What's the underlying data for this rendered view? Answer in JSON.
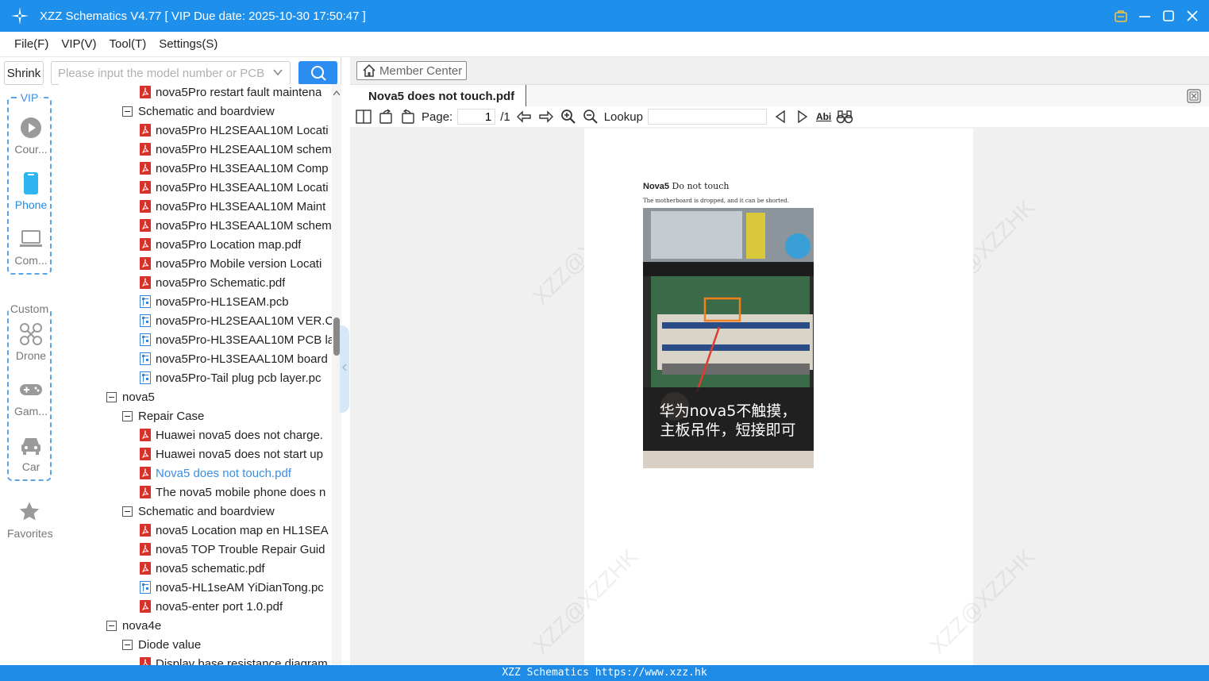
{
  "window": {
    "title": "XZZ Schematics V4.77 [ VIP Due date: 2025-10-30 17:50:47 ]",
    "accent": "#1e90ec"
  },
  "menu": [
    "File(F)",
    "VIP(V)",
    "Tool(T)",
    "Settings(S)"
  ],
  "search": {
    "shrink_label": "Shrink",
    "placeholder": "Please input the model number or PCB"
  },
  "leftnav": {
    "vip_label": "VIP",
    "custom_label": "Custom",
    "items": [
      {
        "label": "Cour...",
        "icon": "play-icon"
      },
      {
        "label": "Phone",
        "icon": "phone-icon"
      },
      {
        "label": "Com...",
        "icon": "laptop-icon"
      },
      {
        "label": "Drone",
        "icon": "drone-icon"
      },
      {
        "label": "Gam...",
        "icon": "gamepad-icon"
      },
      {
        "label": "Car",
        "icon": "car-icon"
      },
      {
        "label": "Favorites",
        "icon": "star-icon"
      }
    ]
  },
  "tree": [
    {
      "level": 2,
      "type": "pdf",
      "text": "nova5Pro restart fault maintena"
    },
    {
      "level": 1,
      "type": "folder",
      "text": "Schematic and boardview"
    },
    {
      "level": 2,
      "type": "pdf",
      "text": "nova5Pro HL2SEAAL10M Locati"
    },
    {
      "level": 2,
      "type": "pdf",
      "text": "nova5Pro HL2SEAAL10M schem"
    },
    {
      "level": 2,
      "type": "pdf",
      "text": "nova5Pro HL3SEAAL10M Comp"
    },
    {
      "level": 2,
      "type": "pdf",
      "text": "nova5Pro HL3SEAAL10M Locati"
    },
    {
      "level": 2,
      "type": "pdf",
      "text": "nova5Pro HL3SEAAL10M Maint"
    },
    {
      "level": 2,
      "type": "pdf",
      "text": "nova5Pro HL3SEAAL10M schem"
    },
    {
      "level": 2,
      "type": "pdf",
      "text": "nova5Pro Location map.pdf"
    },
    {
      "level": 2,
      "type": "pdf",
      "text": "nova5Pro Mobile version Locati"
    },
    {
      "level": 2,
      "type": "pdf",
      "text": "nova5Pro Schematic.pdf"
    },
    {
      "level": 2,
      "type": "pcb",
      "text": "nova5Pro-HL1SEAM.pcb"
    },
    {
      "level": 2,
      "type": "pcb",
      "text": "nova5Pro-HL2SEAAL10M VER.C"
    },
    {
      "level": 2,
      "type": "pcb",
      "text": "nova5Pro-HL3SEAAL10M PCB la"
    },
    {
      "level": 2,
      "type": "pcb",
      "text": "nova5Pro-HL3SEAAL10M board"
    },
    {
      "level": 2,
      "type": "pcb",
      "text": "nova5Pro-Tail plug pcb layer.pc"
    },
    {
      "level": 0,
      "type": "folder",
      "text": "nova5"
    },
    {
      "level": 1,
      "type": "folder",
      "text": "Repair Case"
    },
    {
      "level": 2,
      "type": "pdf",
      "text": "Huawei nova5 does not charge."
    },
    {
      "level": 2,
      "type": "pdf",
      "text": "Huawei nova5 does not start up"
    },
    {
      "level": 2,
      "type": "pdf",
      "text": "Nova5 does not touch.pdf",
      "selected": true
    },
    {
      "level": 2,
      "type": "pdf",
      "text": "The nova5 mobile phone does n"
    },
    {
      "level": 1,
      "type": "folder",
      "text": "Schematic and boardview"
    },
    {
      "level": 2,
      "type": "pdf",
      "text": "nova5 Location map en HL1SEA"
    },
    {
      "level": 2,
      "type": "pdf",
      "text": "nova5 TOP Trouble Repair Guid"
    },
    {
      "level": 2,
      "type": "pdf",
      "text": "nova5 schematic.pdf"
    },
    {
      "level": 2,
      "type": "pcb",
      "text": "nova5-HL1seAM YiDianTong.pc"
    },
    {
      "level": 2,
      "type": "pdf",
      "text": "nova5-enter port 1.0.pdf"
    },
    {
      "level": 0,
      "type": "folder",
      "text": "nova4e"
    },
    {
      "level": 1,
      "type": "folder",
      "text": "Diode value"
    },
    {
      "level": 2,
      "type": "pdf",
      "text": "Display base resistance diagram"
    }
  ],
  "viewer": {
    "member_center": "Member Center",
    "tab_title": "Nova5 does not touch.pdf",
    "page_label": "Page:",
    "page_value": "1",
    "page_total": "/1",
    "lookup_label": "Lookup",
    "abi": "Abi"
  },
  "pdf": {
    "title_bold": "Nova5",
    "title_rest": " Do not touch",
    "subtitle": "The motherboard is dropped, and it can be shorted.",
    "caption_line1": "华为nova5不触摸，",
    "caption_line2": "主板吊件，短接即可",
    "watermark": "XZZ@XZZHK"
  },
  "statusbar": "XZZ Schematics https://www.xzz.hk"
}
